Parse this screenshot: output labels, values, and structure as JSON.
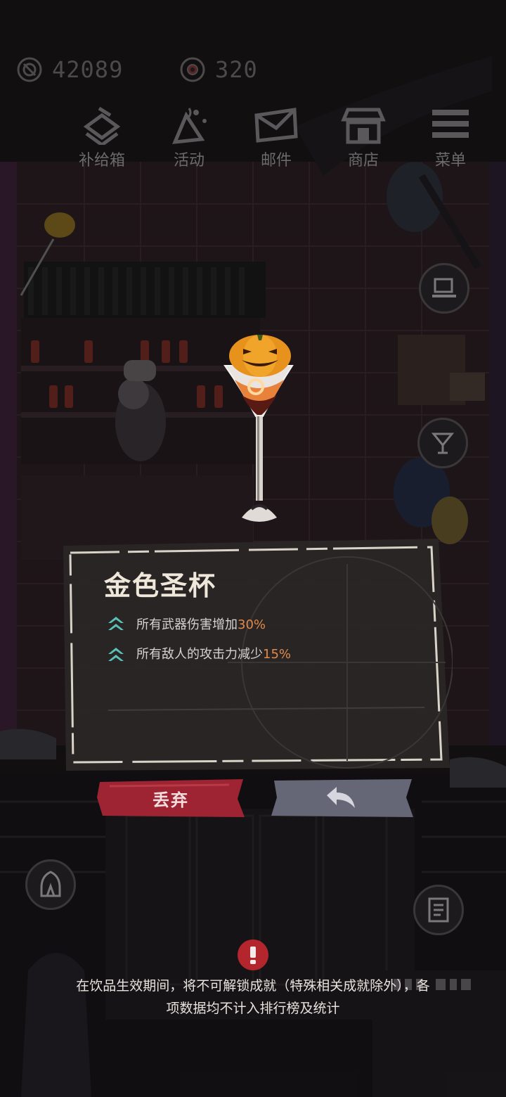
{
  "currency": {
    "coins": "42089",
    "tokens": "320"
  },
  "nav": [
    {
      "label": "补给箱",
      "icon": "supply-box-icon"
    },
    {
      "label": "活动",
      "icon": "event-icon"
    },
    {
      "label": "邮件",
      "icon": "mail-icon"
    },
    {
      "label": "商店",
      "icon": "shop-icon"
    },
    {
      "label": "菜单",
      "icon": "menu-icon"
    }
  ],
  "drink": {
    "name": "金色圣杯",
    "effects": [
      {
        "text": "所有武器伤害增加",
        "value": "30%"
      },
      {
        "text": "所有敌人的攻击力减少",
        "value": "15%"
      }
    ]
  },
  "actions": {
    "discard_label": "丢弃",
    "back_icon": "back-arrow-icon"
  },
  "notice": "在饮品生效期间，将不可解锁成就（特殊相关成就除外），各项数据均不计入排行榜及统计",
  "colors": {
    "discard": "#9e2433",
    "back": "#656676",
    "effect_value": "#e08a4a",
    "upgrade_arrow": "#59c1b6",
    "warning": "#b3262e"
  }
}
